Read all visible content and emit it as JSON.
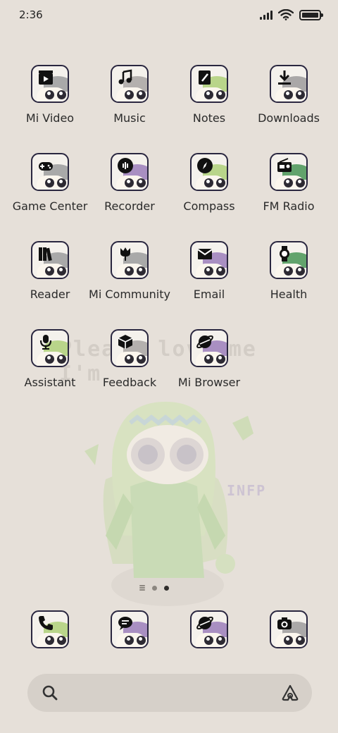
{
  "status_bar": {
    "time": "2:36",
    "icons": [
      "signal-icon",
      "wifi-icon",
      "battery-icon"
    ],
    "battery_level": 1.0
  },
  "wallpaper": {
    "text": "Please love me I'm",
    "tag": "INFP"
  },
  "apps": [
    {
      "label": "Mi Video",
      "icon": "play-icon",
      "hair": "#a9a9a9"
    },
    {
      "label": "Music",
      "icon": "music-note-icon",
      "hair": "#b4b0ae"
    },
    {
      "label": "Notes",
      "icon": "notes-icon",
      "hair": "#b9d58a"
    },
    {
      "label": "Downloads",
      "icon": "download-icon",
      "hair": "#aaa8a8"
    },
    {
      "label": "Game Center",
      "icon": "gamepad-icon",
      "hair": "#a9a9a9"
    },
    {
      "label": "Recorder",
      "icon": "recorder-icon",
      "hair": "#a98fc2"
    },
    {
      "label": "Compass",
      "icon": "compass-icon",
      "hair": "#b9d58a"
    },
    {
      "label": "FM Radio",
      "icon": "radio-icon",
      "hair": "#62a36c"
    },
    {
      "label": "Reader",
      "icon": "books-icon",
      "hair": "#a9a9a9"
    },
    {
      "label": "Mi Community",
      "icon": "tulip-icon",
      "hair": "#a9a9a9"
    },
    {
      "label": "Email",
      "icon": "envelope-icon",
      "hair": "#a98fc2"
    },
    {
      "label": "Health",
      "icon": "watch-icon",
      "hair": "#62a36c"
    },
    {
      "label": "Assistant",
      "icon": "microphone-icon",
      "hair": "#b9d58a"
    },
    {
      "label": "Feedback",
      "icon": "box-icon",
      "hair": "#b4b0ae"
    },
    {
      "label": "Mi Browser",
      "icon": "planet-icon",
      "hair": "#a98fc2"
    }
  ],
  "dock": [
    {
      "name": "phone",
      "icon": "phone-icon",
      "hair": "#b9d58a"
    },
    {
      "name": "messages",
      "icon": "message-icon",
      "hair": "#a98fc2"
    },
    {
      "name": "browser",
      "icon": "planet-icon",
      "hair": "#a98fc2"
    },
    {
      "name": "camera",
      "icon": "camera-icon",
      "hair": "#aaa8a8"
    }
  ],
  "page_indicator": {
    "pages": 3,
    "active": 2
  },
  "search": {
    "icons": [
      "search-icon",
      "assistant-icon"
    ]
  }
}
